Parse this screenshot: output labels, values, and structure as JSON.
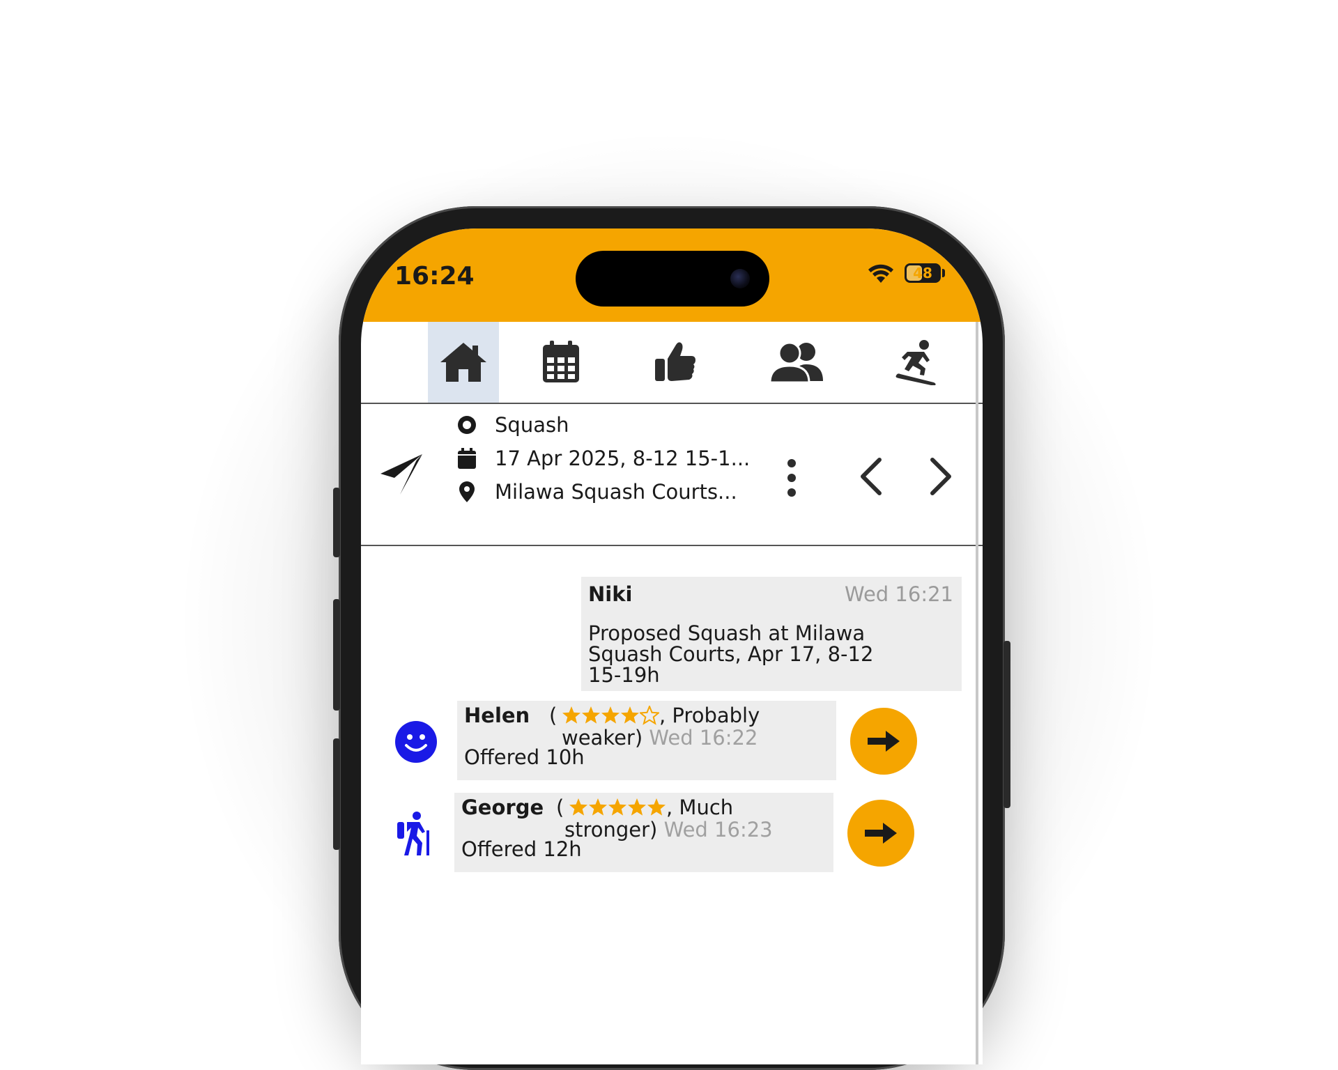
{
  "status_bar": {
    "time": "16:24",
    "battery": "48",
    "battery_level": 0.48
  },
  "nav_tabs": [
    {
      "name": "home",
      "icon": "home-icon",
      "active": true
    },
    {
      "name": "calendar",
      "icon": "calendar-icon",
      "active": false
    },
    {
      "name": "likes",
      "icon": "thumbs-up-icon",
      "active": false
    },
    {
      "name": "friends",
      "icon": "users-icon",
      "active": false
    },
    {
      "name": "sports",
      "icon": "snowboarding-icon",
      "active": false
    }
  ],
  "event": {
    "sport": "Squash",
    "date": "17 Apr 2025, 8-12 15-1...",
    "location": "Milawa Squash Courts..."
  },
  "messages": [
    {
      "sender": "Niki",
      "time": "Wed 16:21",
      "body": "Proposed Squash at Milawa Squash Courts, Apr 17, 8-12 15-19h"
    }
  ],
  "offers": [
    {
      "name": "Helen",
      "avatar_icon": "smiley-icon",
      "stars": 4,
      "stars_max": 5,
      "level_line1": ", Probably",
      "level_line2": "weaker)",
      "time": "Wed 16:22",
      "offered": "Offered 10h"
    },
    {
      "name": "George",
      "avatar_icon": "hiker-icon",
      "stars": 5,
      "stars_max": 5,
      "level_line1": ", Much",
      "level_line2": "stronger)",
      "time": "Wed 16:23",
      "offered": "Offered 12h"
    }
  ],
  "paren_open": "(",
  "colors": {
    "accent": "#f5a500",
    "avatar": "#1a1ae6",
    "active_tab": "#dce4ef",
    "bubble": "#ededed"
  }
}
